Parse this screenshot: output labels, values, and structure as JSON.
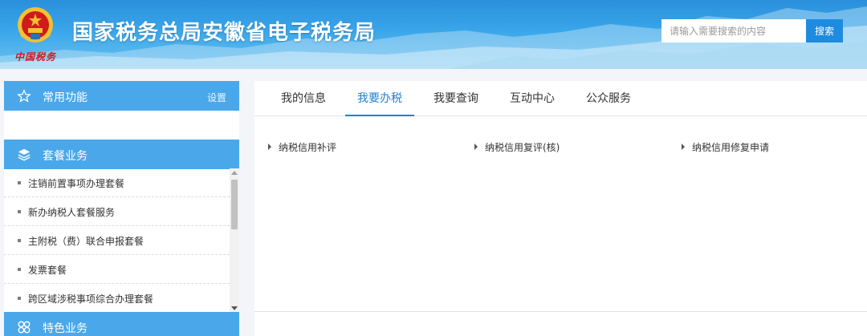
{
  "header": {
    "title": "国家税务总局安徽省电子税务局",
    "brand_script": "中国税务",
    "search_placeholder": "请输入需要搜索的内容",
    "search_button": "搜索",
    "colors": {
      "header_blue": "#3aa6ea",
      "emblem_red": "#d11a1a",
      "emblem_gold": "#f1c232"
    }
  },
  "sidebar": {
    "common": {
      "label": "常用功能",
      "settings_link": "设置",
      "icon": "star-icon"
    },
    "packages": {
      "label": "套餐业务",
      "icon": "layers-icon",
      "items": [
        {
          "label": "注销前置事项办理套餐"
        },
        {
          "label": "新办纳税人套餐服务"
        },
        {
          "label": "主附税（费）联合申报套餐"
        },
        {
          "label": "发票套餐"
        },
        {
          "label": "跨区域涉税事项综合办理套餐"
        }
      ]
    },
    "special": {
      "label": "特色业务",
      "icon": "clover-icon"
    },
    "colors": {
      "section_header": "#4aa8ea"
    }
  },
  "main": {
    "tabs": [
      {
        "label": "我的信息",
        "active": false
      },
      {
        "label": "我要办税",
        "active": true
      },
      {
        "label": "我要查询",
        "active": false
      },
      {
        "label": "互动中心",
        "active": false
      },
      {
        "label": "公众服务",
        "active": false
      }
    ],
    "services": [
      {
        "label": "纳税信用补评"
      },
      {
        "label": "纳税信用复评(核)"
      },
      {
        "label": "纳税信用修复申请"
      }
    ],
    "colors": {
      "active_tab": "#1f7fd4"
    }
  }
}
